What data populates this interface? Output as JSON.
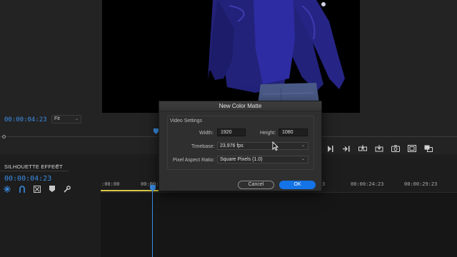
{
  "program_monitor": {
    "timecode": "00:00:04:23",
    "fit_label": "Fit"
  },
  "timeline": {
    "sequence_name": "SILHOUETTE EFFECT",
    "menu_glyph": "≡",
    "timecode": "00:00:04:23",
    "ruler_labels": [
      ":00:00",
      "00:00:0",
      "3",
      "00:00:24:23",
      "00:00:29:23"
    ]
  },
  "dialog": {
    "title": "New Color Matte",
    "group_label": "Video Settings",
    "width_label": "Width:",
    "width_value": "1920",
    "height_label": "Height:",
    "height_value": "1080",
    "timebase_label": "Timebase:",
    "timebase_value": "23.976 fps",
    "par_label": "Pixel Aspect Ratio:",
    "par_value": "Square Pixels (1.0)",
    "cancel_label": "Cancel",
    "ok_label": "OK"
  },
  "icons": {
    "transport": [
      "play-icon",
      "step-forward-icon",
      "insert-icon",
      "overwrite-icon",
      "export-frame-icon",
      "safe-margins-icon",
      "comparison-view-icon"
    ],
    "tools": [
      "snap-icon",
      "linked-selection-icon",
      "add-marker-icon",
      "marker-icon",
      "wrench-icon"
    ]
  },
  "colors": {
    "accent": "#3a8ee6",
    "ok_button": "#1473e6",
    "work_area": "#d9c84a"
  }
}
